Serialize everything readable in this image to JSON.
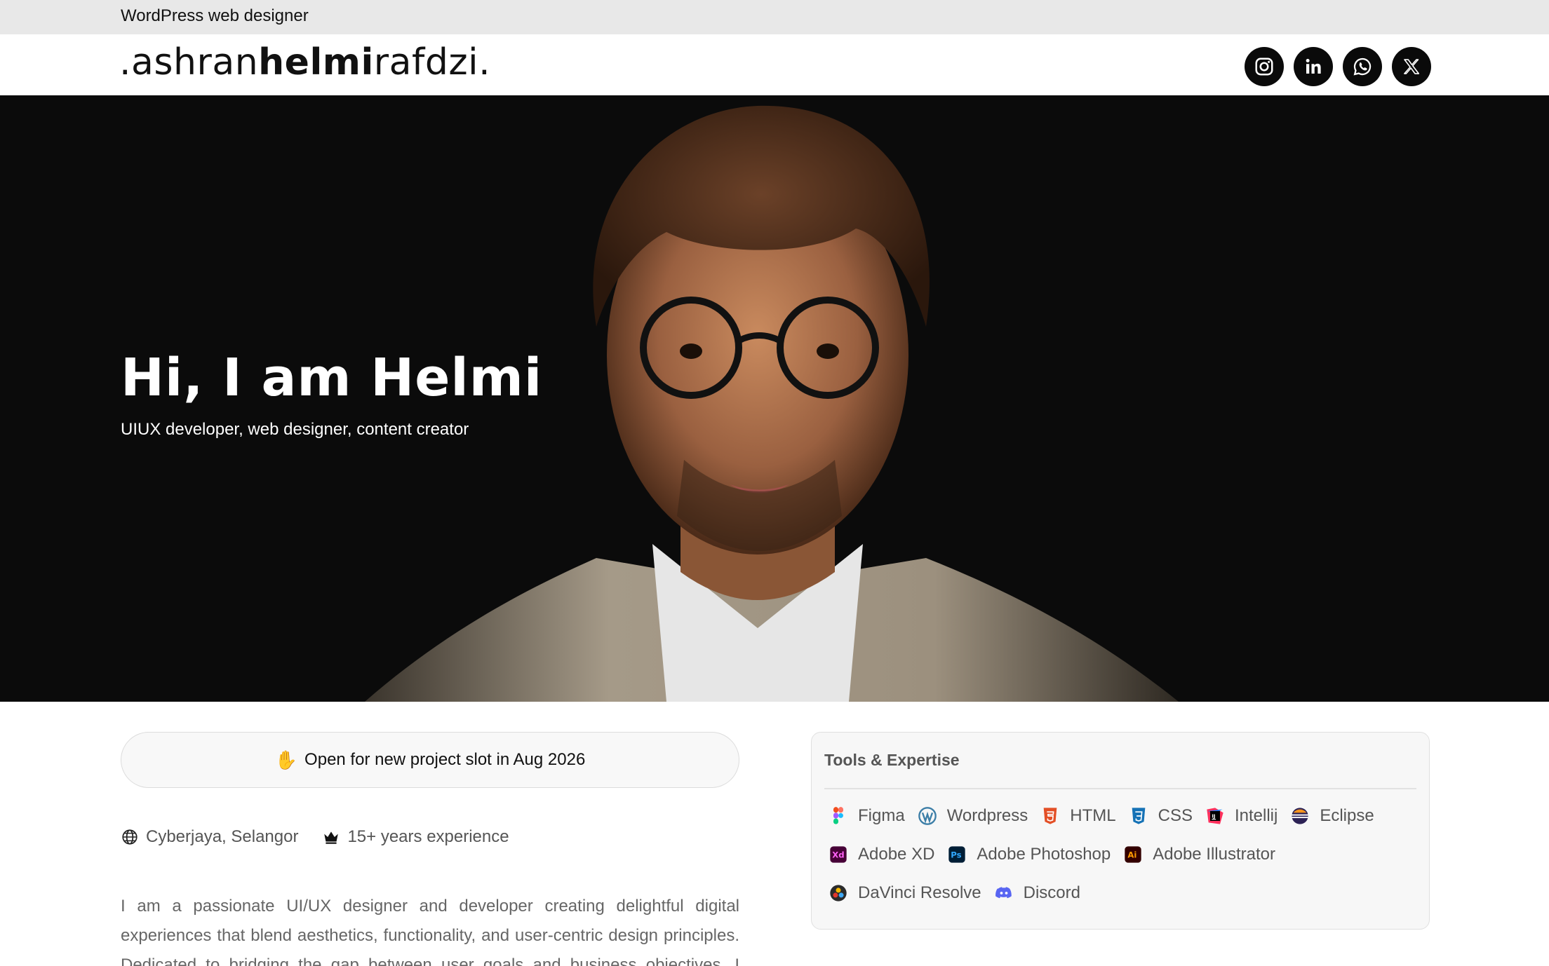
{
  "topbar": {
    "text": "WordPress web designer"
  },
  "header": {
    "logo_prefix": ".ashran",
    "logo_bold": "helmi",
    "logo_suffix": "rafdzi.",
    "socials": [
      "instagram-icon",
      "linkedin-icon",
      "whatsapp-icon",
      "x-icon"
    ]
  },
  "hero": {
    "title": "Hi, I am Helmi",
    "subtitle": "UIUX developer, web designer, content creator"
  },
  "availability": {
    "icon": "waving-hand-icon",
    "text": "Open for new project slot in Aug 2026"
  },
  "meta": {
    "location": "Cyberjaya, Selangor",
    "experience": "15+ years experience"
  },
  "about": {
    "text": "I am a passionate UI/UX designer and developer creating delightful digital experiences that blend aesthetics, functionality, and user-centric design principles. Dedicated to bridging the gap between user goals and business objectives, I design"
  },
  "tools": {
    "title": "Tools & Expertise",
    "items": [
      {
        "label": "Figma",
        "icon": "figma-icon"
      },
      {
        "label": "Wordpress",
        "icon": "wordpress-icon"
      },
      {
        "label": "HTML",
        "icon": "html5-icon"
      },
      {
        "label": "CSS",
        "icon": "css3-icon"
      },
      {
        "label": "Intellij",
        "icon": "intellij-icon"
      },
      {
        "label": "Eclipse",
        "icon": "eclipse-icon"
      },
      {
        "label": "Adobe XD",
        "icon": "adobe-xd-icon"
      },
      {
        "label": "Adobe Photoshop",
        "icon": "photoshop-icon"
      },
      {
        "label": "Adobe Illustrator",
        "icon": "illustrator-icon"
      },
      {
        "label": "DaVinci Resolve",
        "icon": "davinci-resolve-icon"
      },
      {
        "label": "Discord",
        "icon": "discord-icon"
      }
    ]
  },
  "colors": {
    "topbar_bg": "#e8e8e8",
    "hero_bg": "#0b0b0b",
    "social_bg": "#0a0a0a",
    "text_muted": "#555555"
  }
}
